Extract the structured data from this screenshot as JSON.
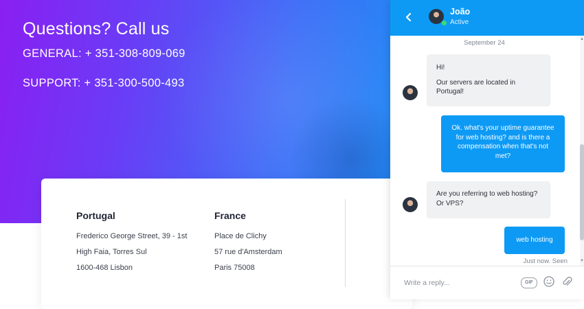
{
  "hero": {
    "title": "Questions? Call us",
    "general": "GENERAL: + 351-308-809-069",
    "support": "SUPPORT: + 351-300-500-493"
  },
  "offices": [
    {
      "country": "Portugal",
      "lines": [
        "Frederico George Street, 39 - 1st",
        "High Faia, Torres Sul",
        "1600-468 Lisbon"
      ]
    },
    {
      "country": "France",
      "lines": [
        "Place de Clichy",
        "57 rue d'Amsterdam",
        "Paris 75008"
      ]
    }
  ],
  "chat": {
    "header": {
      "name": "João",
      "status": "Active",
      "back_icon": "chevron-left-icon"
    },
    "date": "September 24",
    "messages": [
      {
        "from": "agent",
        "paragraphs": [
          "Hi!",
          "Our servers are located in Portugal!"
        ]
      },
      {
        "from": "user",
        "text": "Ok. what's your uptime guarantee for web hosting? and is there a compensation when that's not met?"
      },
      {
        "from": "agent",
        "text": "Are you referring to web hosting? Or VPS?"
      },
      {
        "from": "user",
        "text": "web hosting"
      }
    ],
    "receipt": "Just now. Seen",
    "composer": {
      "placeholder": "Write a reply...",
      "gif_label": "GIF",
      "emoji_icon": "smiley-icon",
      "attach_icon": "paperclip-icon"
    }
  },
  "colors": {
    "accent": "#0d9af5",
    "online": "#3ddc6e"
  }
}
